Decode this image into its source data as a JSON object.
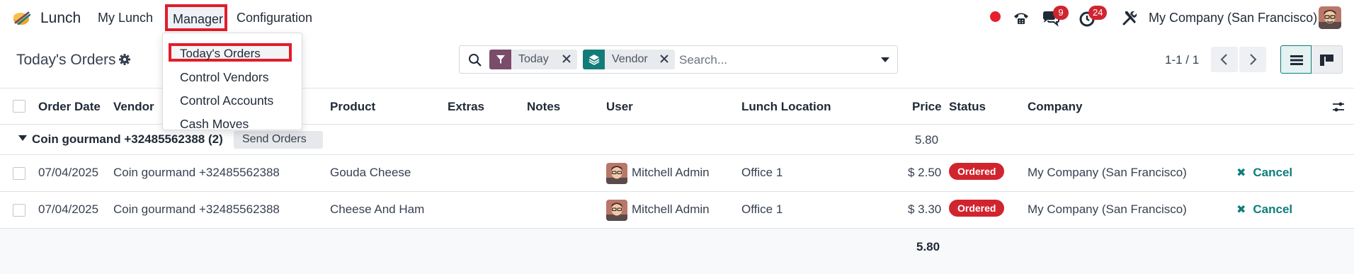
{
  "navbar": {
    "app_name": "Lunch",
    "menu": {
      "my_lunch": "My Lunch",
      "manager": "Manager",
      "configuration": "Configuration"
    },
    "messages_count": "9",
    "activities_count": "24",
    "company": "My Company (San Francisco)"
  },
  "manager_menu": {
    "items": [
      "Today's Orders",
      "Control Vendors",
      "Control Accounts",
      "Cash Moves"
    ]
  },
  "control_panel": {
    "title": "Today's Orders",
    "facets": [
      {
        "label": "Today",
        "icon": "filter-icon"
      },
      {
        "label": "Vendor",
        "icon": "layers-icon"
      }
    ],
    "search_placeholder": "Search...",
    "pager": "1-1 / 1"
  },
  "table": {
    "columns": [
      "Order Date",
      "Vendor",
      "Product",
      "Extras",
      "Notes",
      "User",
      "Lunch Location",
      "Price",
      "Status",
      "Company"
    ],
    "group": {
      "label": "Coin gourmand +32485562388 (2)",
      "action": "Send Orders",
      "total": "5.80"
    },
    "rows": [
      {
        "date": "07/04/2025",
        "vendor": "Coin gourmand +32485562388",
        "product": "Gouda Cheese",
        "extras": "",
        "notes": "",
        "user": "Mitchell Admin",
        "location": "Office 1",
        "price": "$ 2.50",
        "status": "Ordered",
        "company": "My Company (San Francisco)",
        "action": "Cancel"
      },
      {
        "date": "07/04/2025",
        "vendor": "Coin gourmand +32485562388",
        "product": "Cheese And Ham",
        "extras": "",
        "notes": "",
        "user": "Mitchell Admin",
        "location": "Office 1",
        "price": "$ 3.30",
        "status": "Ordered",
        "company": "My Company (San Francisco)",
        "action": "Cancel"
      }
    ],
    "footer_total": "5.80"
  },
  "colors": {
    "brand_primary": "#714B67",
    "accent_teal": "#017E84",
    "status_red": "#D0242F",
    "highlight_outline": "#E11D2A"
  }
}
